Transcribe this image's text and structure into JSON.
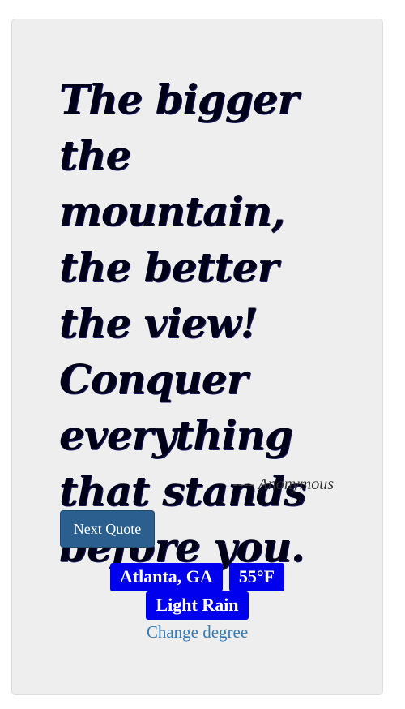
{
  "quote": {
    "text": "The bigger the mountain, the better the view! Conquer everything that stands before you.",
    "author_prefix": "---- ",
    "author": "Anonymous"
  },
  "controls": {
    "next_quote_label": "Next Quote"
  },
  "weather": {
    "location": "Atlanta, GA",
    "temperature": "55°F",
    "condition": "Light Rain",
    "change_degree_label": "Change degree"
  },
  "colors": {
    "card_background": "#eeeeee",
    "button_background": "#2a5f8f",
    "badge_background": "#0000ee",
    "link": "#337ab7"
  }
}
